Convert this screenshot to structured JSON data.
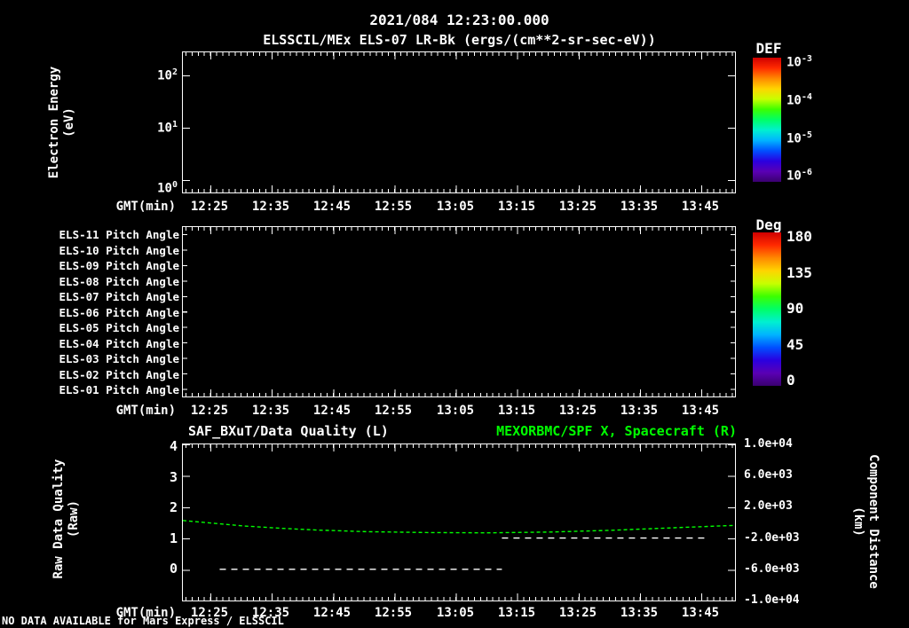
{
  "header": {
    "datetime": "2021/084 12:23:00.000",
    "title": "ELSSCIL/MEx ELS-07 LR-Bk  (ergs/(cm**2-sr-sec-eV))"
  },
  "time_axis": {
    "label": "GMT(min)",
    "ticks": [
      "12:25",
      "12:35",
      "12:45",
      "12:55",
      "13:05",
      "13:15",
      "13:25",
      "13:35",
      "13:45"
    ]
  },
  "panel1": {
    "ylabel": "Electron Energy",
    "ylabel2": "(eV)",
    "yticks": [
      {
        "b": "10",
        "e": "2"
      },
      {
        "b": "10",
        "e": "1"
      },
      {
        "b": "10",
        "e": "0"
      }
    ],
    "colorbar": {
      "title": "DEF",
      "labels": [
        {
          "b": "10",
          "e": "-3"
        },
        {
          "b": "10",
          "e": "-4"
        },
        {
          "b": "10",
          "e": "-5"
        },
        {
          "b": "10",
          "e": "-6"
        }
      ]
    }
  },
  "panel2": {
    "rows": [
      "ELS-11 Pitch Angle",
      "ELS-10 Pitch Angle",
      "ELS-09 Pitch Angle",
      "ELS-08 Pitch Angle",
      "ELS-07 Pitch Angle",
      "ELS-06 Pitch Angle",
      "ELS-05 Pitch Angle",
      "ELS-04 Pitch Angle",
      "ELS-03 Pitch Angle",
      "ELS-02 Pitch Angle",
      "ELS-01 Pitch Angle"
    ],
    "colorbar": {
      "title": "Deg",
      "labels": [
        "180",
        "135",
        "90",
        "45",
        "0"
      ]
    }
  },
  "panel3": {
    "title_left": "SAF_BXuT/Data Quality (L)",
    "title_right": "MEXORBMC/SPF X, Spacecraft (R)",
    "ylabel_left": "Raw Data Quality",
    "ylabel_left2": "(Raw)",
    "ylabel_right": "Component Distance",
    "ylabel_right2": "(km)",
    "yticks_left": [
      "4",
      "3",
      "2",
      "1",
      "0"
    ],
    "yticks_right": [
      "1.0e+04",
      "6.0e+03",
      "2.0e+03",
      "-2.0e+03",
      "-6.0e+03",
      "-1.0e+04"
    ]
  },
  "footer": {
    "message": "NO DATA AVAILABLE for Mars Express / ELSSCIL"
  },
  "colors": {
    "background": "#000000",
    "text": "#ffffff",
    "accent_green": "#00ff00",
    "colorbar_stops": [
      "#d00000",
      "#ff2a00",
      "#ff8800",
      "#ffd400",
      "#c8ff00",
      "#3cff00",
      "#00ff66",
      "#00f0d0",
      "#00b4ff",
      "#0050ff",
      "#2a00e0",
      "#5a00b4",
      "#3a0070"
    ]
  },
  "chart_data": [
    {
      "type": "heatmap",
      "title": "ELSSCIL/MEx ELS-07 LR-Bk (ergs/(cm**2-sr-sec-eV))",
      "subtitle": "2021/084 12:23:00.000",
      "xlabel": "GMT(min)",
      "x_ticks": [
        "12:25",
        "12:35",
        "12:45",
        "12:55",
        "13:05",
        "13:15",
        "13:25",
        "13:35",
        "13:45"
      ],
      "ylabel": "Electron Energy (eV)",
      "yscale": "log",
      "ylim": [
        1,
        200
      ],
      "colorbar": {
        "title": "DEF",
        "units": "ergs/(cm**2-sr-sec-eV)",
        "scale": "log",
        "ticks": [
          "1e-3",
          "1e-4",
          "1e-5",
          "1e-6"
        ]
      },
      "values": [],
      "note": "panel is empty - no data available"
    },
    {
      "type": "heatmap",
      "categories": [
        "ELS-11 Pitch Angle",
        "ELS-10 Pitch Angle",
        "ELS-09 Pitch Angle",
        "ELS-08 Pitch Angle",
        "ELS-07 Pitch Angle",
        "ELS-06 Pitch Angle",
        "ELS-05 Pitch Angle",
        "ELS-04 Pitch Angle",
        "ELS-03 Pitch Angle",
        "ELS-02 Pitch Angle",
        "ELS-01 Pitch Angle"
      ],
      "xlabel": "GMT(min)",
      "x_ticks": [
        "12:25",
        "12:35",
        "12:45",
        "12:55",
        "13:05",
        "13:15",
        "13:25",
        "13:35",
        "13:45"
      ],
      "colorbar": {
        "title": "Deg",
        "range": [
          0,
          180
        ],
        "ticks": [
          180,
          135,
          90,
          45,
          0
        ]
      },
      "values": [],
      "note": "panel is empty - no data available"
    },
    {
      "type": "line",
      "titles": [
        "SAF_BXuT/Data Quality (L)",
        "MEXORBMC/SPF X, Spacecraft (R)"
      ],
      "xlabel": "GMT(min)",
      "x_ticks": [
        "12:25",
        "12:35",
        "12:45",
        "12:55",
        "13:05",
        "13:15",
        "13:25",
        "13:35",
        "13:45"
      ],
      "x_start": "12:23",
      "x_minutes_range": [
        0,
        90
      ],
      "left_axis": {
        "label": "Raw Data Quality (Raw)",
        "ticks": [
          4,
          3,
          2,
          1,
          0
        ],
        "range": [
          -1,
          4
        ]
      },
      "right_axis": {
        "label": "Component Distance (km)",
        "ticks": [
          10000,
          6000,
          2000,
          -2000,
          -6000,
          -10000
        ],
        "range": [
          -10000,
          10000
        ]
      },
      "series": [
        {
          "name": "SAF_BXuT/Data Quality (L)",
          "axis": "left",
          "color": "#ffffff",
          "style": "dashed",
          "segments": [
            {
              "x_minutes": [
                6,
                52
              ],
              "value": 0
            },
            {
              "x_minutes": [
                52,
                85
              ],
              "value": 1
            }
          ]
        },
        {
          "name": "MEXORBMC/SPF X, Spacecraft (R)",
          "axis": "right",
          "color": "#00ff00",
          "style": "dashed",
          "points": [
            {
              "t": 0,
              "km": 250
            },
            {
              "t": 5,
              "km": -100
            },
            {
              "t": 10,
              "km": -450
            },
            {
              "t": 16,
              "km": -750
            },
            {
              "t": 22,
              "km": -980
            },
            {
              "t": 30,
              "km": -1180
            },
            {
              "t": 40,
              "km": -1300
            },
            {
              "t": 50,
              "km": -1330
            },
            {
              "t": 60,
              "km": -1230
            },
            {
              "t": 70,
              "km": -1000
            },
            {
              "t": 80,
              "km": -680
            },
            {
              "t": 90,
              "km": -380
            }
          ]
        }
      ]
    }
  ]
}
